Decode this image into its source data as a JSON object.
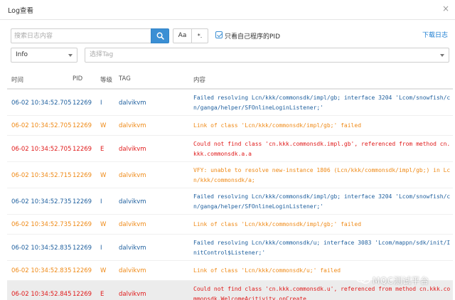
{
  "window": {
    "title": "Log查看"
  },
  "toolbar": {
    "search_placeholder": "搜索日志内容",
    "case_label": "Aa",
    "regex_label": "*.",
    "own_pid_label": "只看自己程序的PID",
    "download_label": "下载日志",
    "level_value": "Info",
    "tag_placeholder": "选择Tag"
  },
  "table": {
    "headers": [
      "时间",
      "PID",
      "等级",
      "TAG",
      "内容"
    ],
    "rows": [
      {
        "time": "06-02 10:34:52.705",
        "pid": "12269",
        "level": "I",
        "tag": "dalvikvm",
        "message": "Failed resolving Lcn/kkk/commonsdk/impl/gb; interface 3204 'Lcom/snowfish/cn/ganga/helper/SFOnlineLoginListener;'"
      },
      {
        "time": "06-02 10:34:52.705",
        "pid": "12269",
        "level": "W",
        "tag": "dalvikvm",
        "message": "Link of class 'Lcn/kkk/commonsdk/impl/gb;' failed"
      },
      {
        "time": "06-02 10:34:52.705",
        "pid": "12269",
        "level": "E",
        "tag": "dalvikvm",
        "message": "Could not find class 'cn.kkk.commonsdk.impl.gb', referenced from method cn.kkk.commonsdk.a.a"
      },
      {
        "time": "06-02 10:34:52.715",
        "pid": "12269",
        "level": "W",
        "tag": "dalvikvm",
        "message": "VFY: unable to resolve new-instance 1806 (Lcn/kkk/commonsdk/impl/gb;) in Lcn/kkk/commonsdk/a;"
      },
      {
        "time": "06-02 10:34:52.735",
        "pid": "12269",
        "level": "I",
        "tag": "dalvikvm",
        "message": "Failed resolving Lcn/kkk/commonsdk/impl/gb; interface 3204 'Lcom/snowfish/cn/ganga/helper/SFOnlineLoginListener;'"
      },
      {
        "time": "06-02 10:34:52.735",
        "pid": "12269",
        "level": "W",
        "tag": "dalvikvm",
        "message": "Link of class 'Lcn/kkk/commonsdk/impl/gb;' failed"
      },
      {
        "time": "06-02 10:34:52.835",
        "pid": "12269",
        "level": "I",
        "tag": "dalvikvm",
        "message": "Failed resolving Lcn/kkk/commonsdk/u; interface 3083 'Lcom/mappn/sdk/init/InitControl$Listener;'"
      },
      {
        "time": "06-02 10:34:52.835",
        "pid": "12269",
        "level": "W",
        "tag": "dalvikvm",
        "message": "Link of class 'Lcn/kkk/commonsdk/u;' failed"
      },
      {
        "time": "06-02 10:34:52.845",
        "pid": "12269",
        "level": "E",
        "tag": "dalvikvm",
        "message": "Could not find class 'cn.kkk.commonsdk.u', referenced from method cn.kkk.commonsdk.WelcomeAcitivity.onCreate",
        "highlighted": true
      }
    ]
  },
  "watermark": {
    "text": "MQC测试平台"
  },
  "colors": {
    "info": "#1e5f9e",
    "warn": "#ef8a17",
    "error": "#e01919",
    "accent": "#3b8fd4"
  }
}
